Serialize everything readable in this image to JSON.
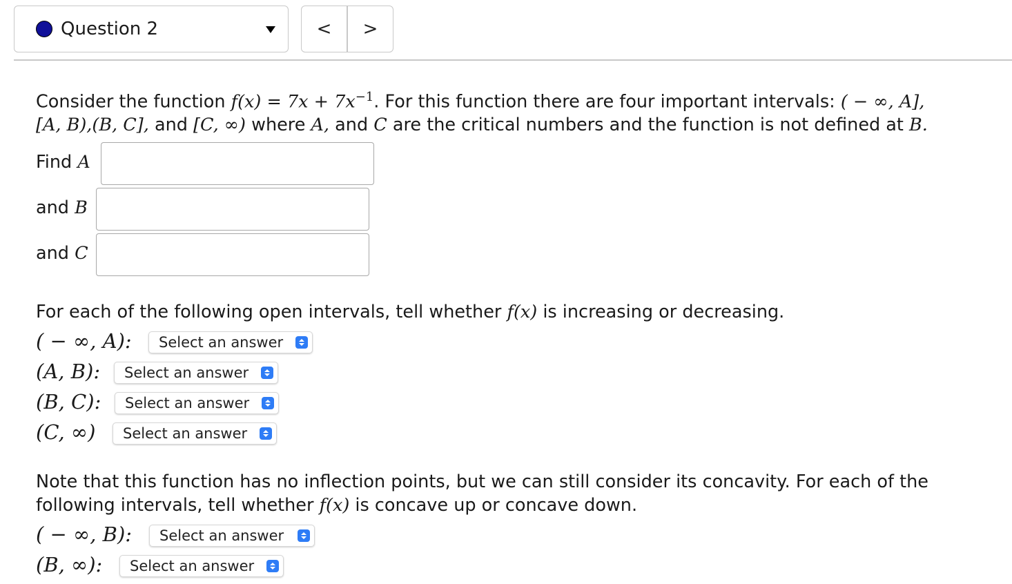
{
  "header": {
    "question_label": "Question 2",
    "prev_label": "<",
    "next_label": ">"
  },
  "problem": {
    "line1_part1": "Consider the function ",
    "line1_part2": ". For this function there are four important intervals: ",
    "line2_part1": " and ",
    "line2_part2": " where ",
    "line2_part3": " and ",
    "line2_part4": " are the critical numbers and the function is not defined at ",
    "func_lhs": "f(x)",
    "func_eq": " = ",
    "func_rhs": "7x + 7x",
    "func_exp": "−1",
    "interval1": "( − ∞, A],",
    "interval2": "[A, B),(B, C],",
    "interval3": "[C, ∞)",
    "var_A": "A,",
    "var_C": "C",
    "var_B_end": "B."
  },
  "inputs": {
    "find_a_label": "Find ",
    "and_b_label": "and ",
    "and_c_label": "and ",
    "var_A": "A",
    "var_B": "B",
    "var_C": "C",
    "a_value": "",
    "b_value": "",
    "c_value": ""
  },
  "increasing": {
    "prompt_part1": "For each of the following open intervals, tell whether ",
    "prompt_fx": "f(x)",
    "prompt_part2": " is increasing or decreasing.",
    "rows": [
      {
        "interval": "( − ∞, A):",
        "selected": "Select an answer"
      },
      {
        "interval": "(A, B):",
        "selected": "Select an answer"
      },
      {
        "interval": "(B, C):",
        "selected": "Select an answer"
      },
      {
        "interval": "(C, ∞)",
        "selected": "Select an answer"
      }
    ]
  },
  "concavity": {
    "prompt_line1": "Note that this function has no inflection points, but we can still consider its concavity. For each of the",
    "prompt_line2_part1": "following intervals, tell whether ",
    "prompt_fx": "f(x)",
    "prompt_line2_part2": " is concave up or concave down.",
    "rows": [
      {
        "interval": "( − ∞, B):",
        "selected": "Select an answer"
      },
      {
        "interval": "(B, ∞):",
        "selected": "Select an answer"
      }
    ]
  },
  "colors": {
    "question_dot": "#101099",
    "stepper_accent": "#2e7cf6",
    "border": "#c8c8c8"
  },
  "icons": {
    "question_status": "filled-circle-icon",
    "dropdown": "caret-down-icon",
    "select_stepper": "up-down-chevron-icon"
  }
}
